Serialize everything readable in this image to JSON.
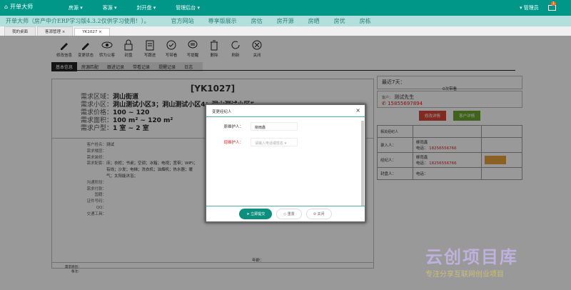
{
  "header": {
    "logo": "开单大师",
    "nav": [
      "房源 ▾",
      "客源 ▾",
      "封开盘 ▾",
      "管理后台 ▾"
    ],
    "user": "▾ 管理员",
    "mail_count": "1"
  },
  "banner": {
    "title": "开单大师（房产中介ERP学习版4.3.2仅供学习使用！）。",
    "links": [
      "官方网站",
      "尊享版展示",
      "房估",
      "房开源",
      "房晒",
      "房优",
      "房栋"
    ]
  },
  "tabs": [
    {
      "label": "我的桌面"
    },
    {
      "label": "客源管理 ×"
    },
    {
      "label": "YK1027 ×"
    }
  ],
  "toolbar": [
    "修改信息",
    "变更状态",
    "转为公客",
    "封盘",
    "写跟进",
    "写带看",
    "写提醒",
    "删除",
    "刷新",
    "关闭"
  ],
  "subtabs": [
    "基本信息",
    "房源匹配",
    "跟进记录",
    "带看记录",
    "提醒记录",
    "日志"
  ],
  "detail": {
    "title": "[YK1027]",
    "req": [
      {
        "k": "需求区域：",
        "v": "洞山街道"
      },
      {
        "k": "需求小区：",
        "v": "洞山测试小区3；洞山测试小区4；洞山测试小区5"
      },
      {
        "k": "需求价格：",
        "v": "100 ~ 120"
      },
      {
        "k": "需求面积：",
        "v": "100 m² ~ 120 m²"
      },
      {
        "k": "需求户型：",
        "v": "1 室 ~ 2 室"
      }
    ],
    "info": [
      {
        "k": "客户姓名：",
        "v": "测试"
      },
      {
        "k": "需求楼层：",
        "v": ""
      },
      {
        "k": "需求装修：",
        "v": ""
      },
      {
        "k": "需求配套：",
        "v": "床；衣柜；书桌；空调；冰箱；电视；宽带；WIFI；"
      },
      {
        "k": "",
        "v": "有线；沙发；电梯；洗衣机；油烟机；热水器；暖"
      },
      {
        "k": "",
        "v": "气；太阳能沐浴；"
      },
      {
        "k": "沟通阶段：",
        "v": ""
      },
      {
        "k": "需求付款：",
        "v": ""
      },
      {
        "k": "国籍：",
        "v": ""
      },
      {
        "k": "证件号码：",
        "v": ""
      },
      {
        "k": "QQ：",
        "v": ""
      },
      {
        "k": "交通工具：",
        "v": ""
      }
    ],
    "age_label": "年龄：",
    "source": "需求原因：",
    "remark": "备注："
  },
  "right": {
    "recent": "最近7天：",
    "views": "0次带看",
    "cust_label": "客户：",
    "cust": "测试先生",
    "phone": "15855697894",
    "btn_edit": "修改详情",
    "btn_detail": "客户详情",
    "agents_title": "相关经纪人",
    "rows": [
      {
        "role": "录入人：",
        "name": "柳雨鑫",
        "tel_label": "电话：",
        "tel": "18256556766"
      },
      {
        "role": "经纪人：",
        "name": "柳雨鑫",
        "tel_label": "电话：",
        "tel": "18256556766"
      },
      {
        "role": "封盘人：",
        "name": "",
        "tel_label": "电话：",
        "tel": ""
      }
    ]
  },
  "modal": {
    "title": "变更经纪人",
    "orig_label": "原维护人：",
    "orig_value": "柳雨鑫",
    "new_label": "现维护人：",
    "new_placeholder": "请输入电话或姓名",
    "submit": "立即提交",
    "reset": "重置",
    "close": "关闭"
  },
  "watermark": {
    "line1": "云创项目库",
    "line2": "专注分享互联网创业项目"
  },
  "colors": {
    "primary": "#009688",
    "banner": "#b3dfdc",
    "danger": "#d22222"
  }
}
